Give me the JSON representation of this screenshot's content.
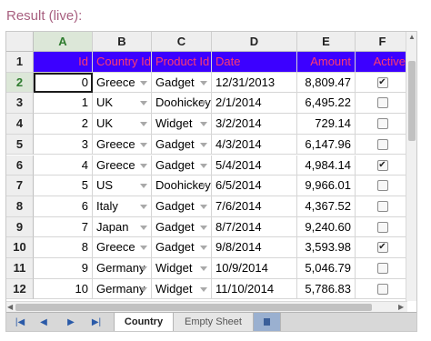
{
  "result_label": "Result (live):",
  "columns": [
    "A",
    "B",
    "C",
    "D",
    "E",
    "F"
  ],
  "selected_column": "A",
  "header_row": {
    "row_label": "1",
    "cells": [
      "Id",
      "Country Id",
      "Product Id",
      "Date",
      "Amount",
      "Active"
    ]
  },
  "rows": [
    {
      "row_label": "2",
      "id": "0",
      "country": "Greece",
      "product": "Gadget",
      "date": "12/31/2013",
      "amount": "8,809.47",
      "active": true
    },
    {
      "row_label": "3",
      "id": "1",
      "country": "UK",
      "product": "Doohickey",
      "date": "2/1/2014",
      "amount": "6,495.22",
      "active": false
    },
    {
      "row_label": "4",
      "id": "2",
      "country": "UK",
      "product": "Widget",
      "date": "3/2/2014",
      "amount": "729.14",
      "active": false
    },
    {
      "row_label": "5",
      "id": "3",
      "country": "Greece",
      "product": "Gadget",
      "date": "4/3/2014",
      "amount": "6,147.96",
      "active": false
    },
    {
      "row_label": "6",
      "id": "4",
      "country": "Greece",
      "product": "Gadget",
      "date": "5/4/2014",
      "amount": "4,984.14",
      "active": true
    },
    {
      "row_label": "7",
      "id": "5",
      "country": "US",
      "product": "Doohickey",
      "date": "6/5/2014",
      "amount": "9,966.01",
      "active": false
    },
    {
      "row_label": "8",
      "id": "6",
      "country": "Italy",
      "product": "Gadget",
      "date": "7/6/2014",
      "amount": "4,367.52",
      "active": false
    },
    {
      "row_label": "9",
      "id": "7",
      "country": "Japan",
      "product": "Gadget",
      "date": "8/7/2014",
      "amount": "9,240.60",
      "active": false
    },
    {
      "row_label": "10",
      "id": "8",
      "country": "Greece",
      "product": "Gadget",
      "date": "9/8/2014",
      "amount": "3,593.98",
      "active": true
    },
    {
      "row_label": "11",
      "id": "9",
      "country": "Germany",
      "product": "Widget",
      "date": "10/9/2014",
      "amount": "5,046.79",
      "active": false
    },
    {
      "row_label": "12",
      "id": "10",
      "country": "Germany",
      "product": "Widget",
      "date": "11/10/2014",
      "amount": "5,786.83",
      "active": false
    }
  ],
  "selected_row": "2",
  "sheet_tabs": [
    {
      "label": "Country",
      "active": true
    },
    {
      "label": "Empty Sheet",
      "active": false
    }
  ],
  "nav_icons": [
    "first-sheet-icon",
    "prev-sheet-icon",
    "next-sheet-icon",
    "last-sheet-icon"
  ],
  "colors": {
    "header_bg": "#3c00ff",
    "header_text": "#ff3b6f",
    "selection_header_bg": "#dce7d8",
    "selection_header_text": "#2f7c2f"
  }
}
